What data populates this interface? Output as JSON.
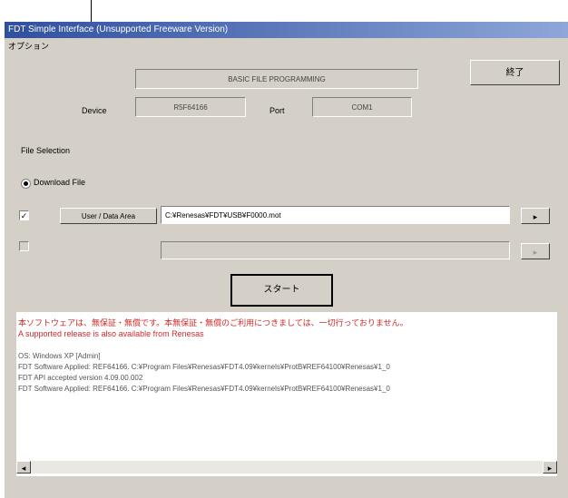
{
  "window": {
    "title": "FDT Simple Interface   (Unsupported Freeware Version)",
    "menu": "オプション",
    "mode_label": "BASIC FILE PROGRAMMING",
    "exit_button": "終了",
    "device_label": "Device",
    "device_value": "R5F64166",
    "port_label": "Port",
    "port_value": "COM1",
    "file_selection_label": "File Selection",
    "download_file_label": "Download File",
    "user_data_area_button": "User / Data Area",
    "file_path": "C:¥Renesas¥FDT¥USB¥F0000.mot",
    "start_button": "スタート"
  },
  "console": {
    "lines": [
      "本ソフトウェアは、無保証・無償です。本無保証・無償のご利用につきましては、一切行っておりません。",
      "A supported release is also available from Renesas",
      "OS: Windows XP [Admin]",
      "FDT Software Applied: REF64166. C:¥Program Files¥Renesas¥FDT4.09¥kernels¥ProtB¥REF64100¥Renesas¥1_0",
      "FDT API accepted version 4.09.00.002",
      "FDT Software Applied: REF64166. C:¥Program Files¥Renesas¥FDT4.09¥kernels¥ProtB¥REF64100¥Renesas¥1_0"
    ]
  },
  "colors": {
    "accent": "#d02a2a",
    "title_bg": "#2f4f9f"
  }
}
